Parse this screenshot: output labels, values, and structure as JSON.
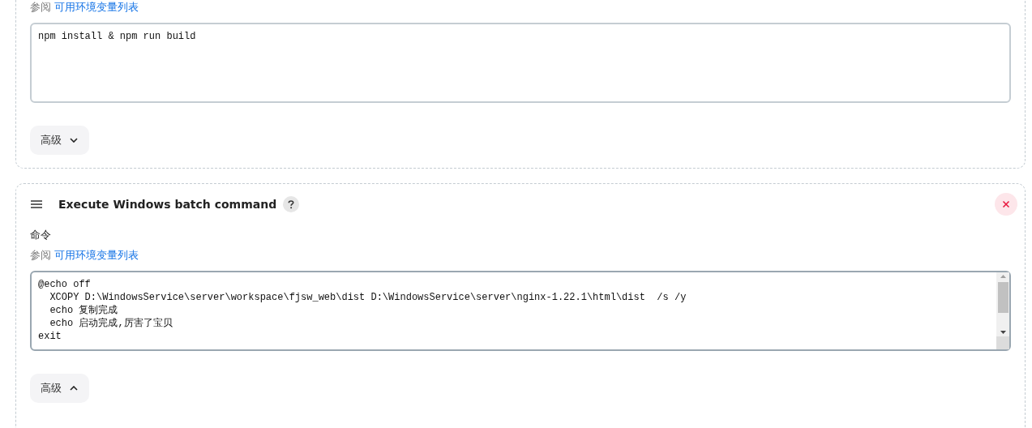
{
  "cards": [
    {
      "see_text": "参阅",
      "env_link": "可用环境变量列表",
      "command": "npm install & npm run build",
      "scrollbar": false,
      "advanced": {
        "label": "高级",
        "expanded": false
      }
    },
    {
      "title": "Execute Windows batch command",
      "field_label": "命令",
      "see_text": "参阅",
      "env_link": "可用环境变量列表",
      "command": "@echo off\n  XCOPY D:\\WindowsService\\server\\workspace\\fjsw_web\\dist D:\\WindowsService\\server\\nginx-1.22.1\\html\\dist  /s /y\n  echo 复制完成\n  echo 启动完成,厉害了宝贝\nexit",
      "scrollbar": true,
      "advanced": {
        "label": "高级",
        "expanded": true
      }
    }
  ]
}
